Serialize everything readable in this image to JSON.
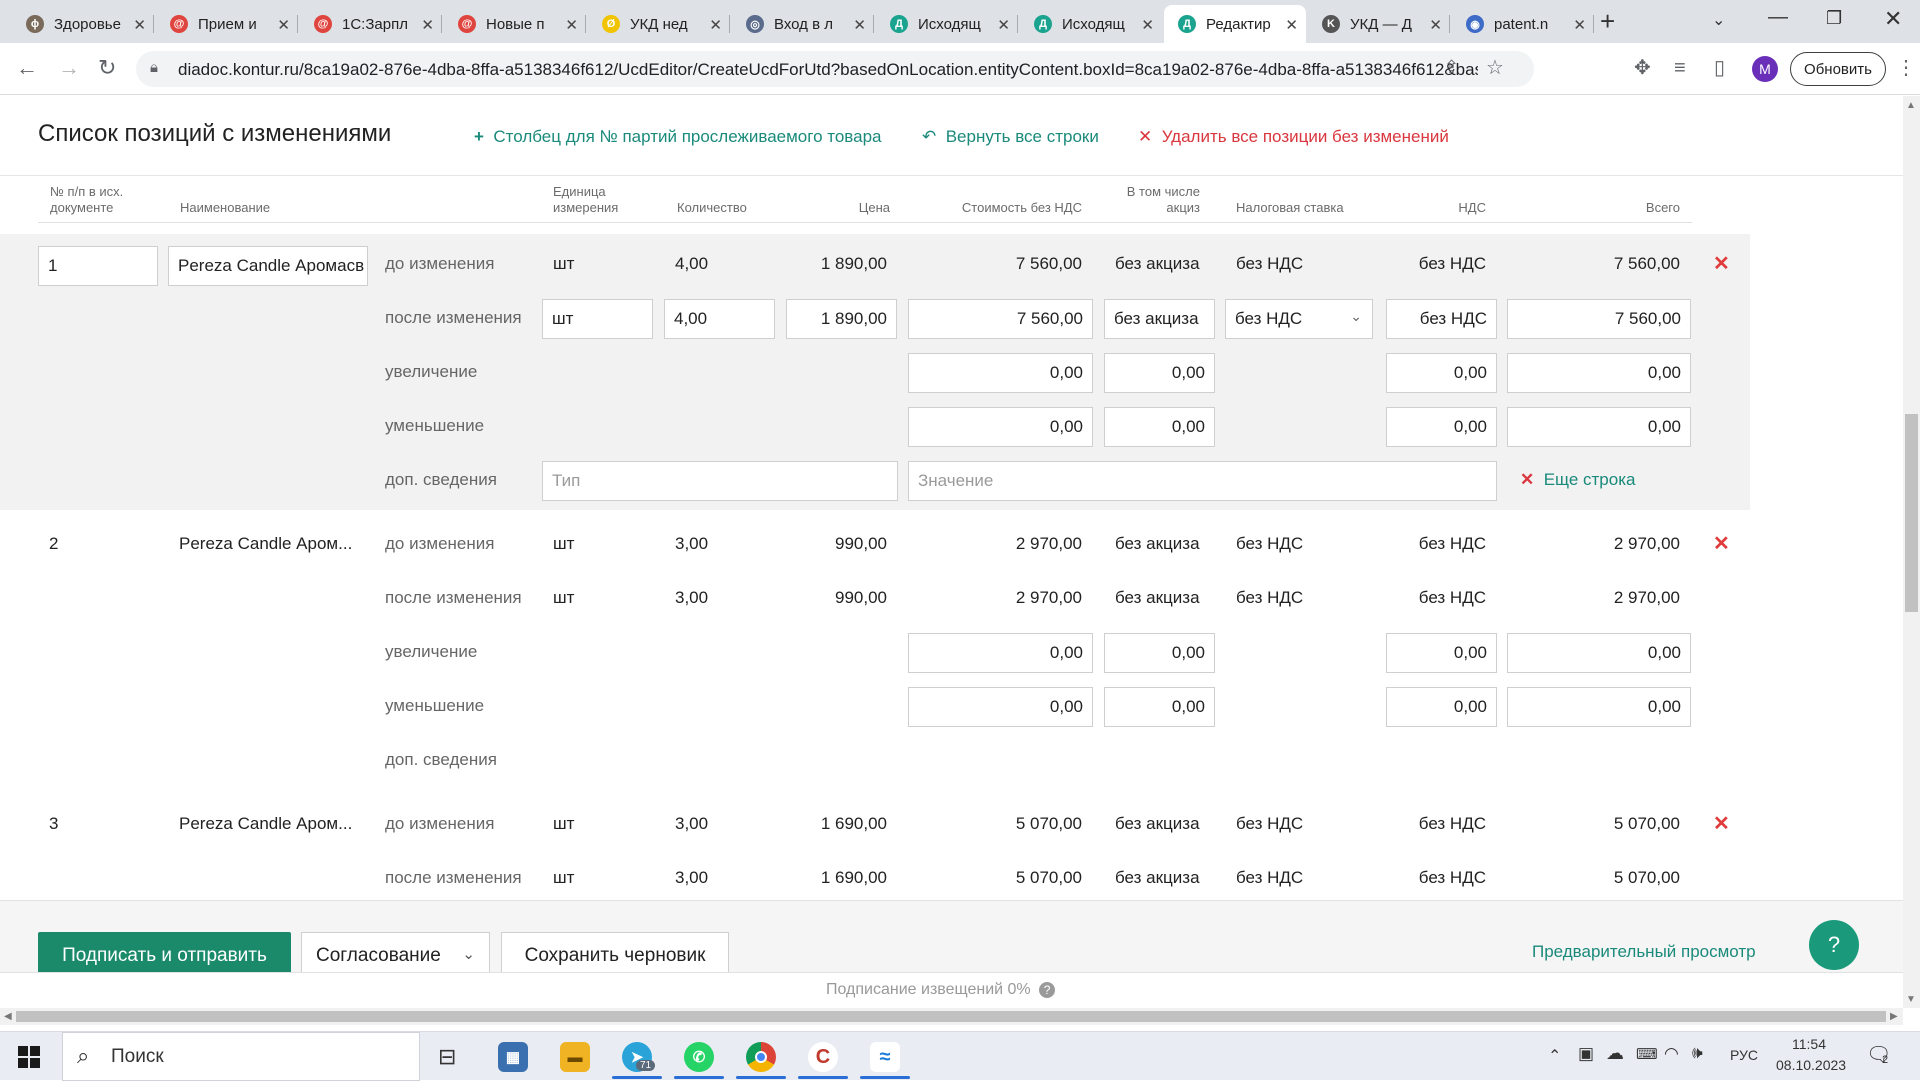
{
  "browser": {
    "tabs": [
      {
        "label": "Здоровье",
        "fav": "#7a6a5a",
        "glyph": "ϕ"
      },
      {
        "label": "Прием и",
        "fav": "#e0443e",
        "glyph": "@"
      },
      {
        "label": "1С:Зарпл",
        "fav": "#e0443e",
        "glyph": "@"
      },
      {
        "label": "Новые п",
        "fav": "#e0443e",
        "glyph": "@"
      },
      {
        "label": "УКД нед",
        "fav": "#f2c400",
        "glyph": "Ø"
      },
      {
        "label": "Вход в л",
        "fav": "#5b6b8c",
        "glyph": "◎"
      },
      {
        "label": "Исходящ",
        "fav": "#1aa38e",
        "glyph": "Д"
      },
      {
        "label": "Исходящ",
        "fav": "#1aa38e",
        "glyph": "Д"
      },
      {
        "label": "Редактир",
        "fav": "#1aa38e",
        "glyph": "Д"
      },
      {
        "label": "УКД — Д",
        "fav": "#555555",
        "glyph": "K"
      },
      {
        "label": "patent.n",
        "fav": "#3d6bc7",
        "glyph": "◉"
      }
    ],
    "new_tab": "+",
    "url": "diadoc.kontur.ru/8ca19a02-876e-4dba-8ffa-a5138346f612/UcdEditor/CreateUcdForUtd?basedOnLocation.entityContent.boxId=8ca19a02-876e-4dba-8ffa-a5138346f612&bas...",
    "profile_initial": "M",
    "update_label": "Обновить"
  },
  "section": {
    "title": "Список позиций с изменениями",
    "action_add": "Столбец для № партий прослеживаемого товара",
    "action_revert": "Вернуть все строки",
    "action_delete": "Удалить все позиции без изменений"
  },
  "columns": {
    "num": "№ п/п в исх. документе",
    "name": "Наименование",
    "unit": "Единица измерения",
    "qty": "Количество",
    "price": "Цена",
    "cost": "Стоимость без НДС",
    "excise": "В том числе акциз",
    "rate": "Налоговая ставка",
    "vat": "НДС",
    "total": "Всего"
  },
  "row_labels": {
    "before": "до изменения",
    "after": "после изменения",
    "increase": "увеличение",
    "decrease": "уменьшение",
    "extra": "доп. сведения"
  },
  "items": [
    {
      "num": "1",
      "name": "Pereza Candle Аромасв",
      "before": {
        "unit": "шт",
        "qty": "4,00",
        "price": "1 890,00",
        "cost": "7 560,00",
        "excise": "без акциза",
        "rate": "без НДС",
        "vat": "без НДС",
        "total": "7 560,00"
      },
      "after": {
        "unit": "шт",
        "qty": "4,00",
        "price": "1 890,00",
        "cost": "7 560,00",
        "excise": "без акциза",
        "rate": "без НДС",
        "vat": "без НДС",
        "total": "7 560,00"
      },
      "increase": {
        "cost": "0,00",
        "excise": "0,00",
        "vat": "0,00",
        "total": "0,00"
      },
      "decrease": {
        "cost": "0,00",
        "excise": "0,00",
        "vat": "0,00",
        "total": "0,00"
      },
      "extra_type_placeholder": "Тип",
      "extra_value_placeholder": "Значение",
      "more_row": "Еще строка"
    },
    {
      "num": "2",
      "name": "Pereza Candle Аром...",
      "before": {
        "unit": "шт",
        "qty": "3,00",
        "price": "990,00",
        "cost": "2 970,00",
        "excise": "без акциза",
        "rate": "без НДС",
        "vat": "без НДС",
        "total": "2 970,00"
      },
      "after": {
        "unit": "шт",
        "qty": "3,00",
        "price": "990,00",
        "cost": "2 970,00",
        "excise": "без акциза",
        "rate": "без НДС",
        "vat": "без НДС",
        "total": "2 970,00"
      },
      "increase": {
        "cost": "0,00",
        "excise": "0,00",
        "vat": "0,00",
        "total": "0,00"
      },
      "decrease": {
        "cost": "0,00",
        "excise": "0,00",
        "vat": "0,00",
        "total": "0,00"
      }
    },
    {
      "num": "3",
      "name": "Pereza Candle Аром...",
      "before": {
        "unit": "шт",
        "qty": "3,00",
        "price": "1 690,00",
        "cost": "5 070,00",
        "excise": "без акциза",
        "rate": "без НДС",
        "vat": "без НДС",
        "total": "5 070,00"
      },
      "after": {
        "unit": "шт",
        "qty": "3,00",
        "price": "1 690,00",
        "cost": "5 070,00",
        "excise": "без акциза",
        "rate": "без НДС",
        "vat": "без НДС",
        "total": "5 070,00"
      }
    }
  ],
  "footer": {
    "sign_send": "Подписать и отправить",
    "approval": "Согласование",
    "save_draft": "Сохранить черновик",
    "preview": "Предварительный просмотр",
    "help": "?",
    "notice": "Подписание извещений 0%"
  },
  "taskbar": {
    "search": "Поиск",
    "lang": "РУС",
    "time": "11:54",
    "date": "08.10.2023",
    "telegram_badge": "71",
    "notif_count": "2"
  },
  "colors": {
    "accent": "#1a8a7b",
    "primary_button": "#1a8a6b",
    "danger": "#e23b3b",
    "row_highlight": "#f2f2f2"
  }
}
